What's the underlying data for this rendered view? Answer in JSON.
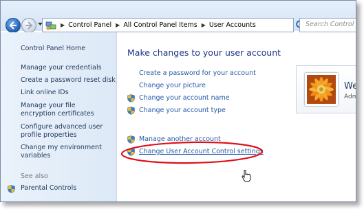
{
  "breadcrumb": {
    "items": [
      "Control Panel",
      "All Control Panel Items",
      "User Accounts"
    ]
  },
  "search": {
    "placeholder": "Search Control Panel"
  },
  "sidebar": {
    "home": "Control Panel Home",
    "links": [
      "Manage your credentials",
      "Create a password reset disk",
      "Link online IDs",
      "Manage your file encryption certificates",
      "Configure advanced user profile properties",
      "Change my environment variables"
    ],
    "see_also_label": "See also",
    "see_also_links": [
      "Parental Controls"
    ]
  },
  "main": {
    "heading": "Make changes to your user account",
    "tasks": [
      "Create a password for your account",
      "Change your picture",
      "Change your account name",
      "Change your account type"
    ],
    "other_tasks": [
      "Manage another account",
      "Change User Account Control settings"
    ]
  },
  "user": {
    "name_visible": "We",
    "type_visible": "Adm"
  },
  "colors": {
    "link": "#2559a8",
    "heading": "#1e3287",
    "highlight_ellipse": "#e0101a"
  }
}
